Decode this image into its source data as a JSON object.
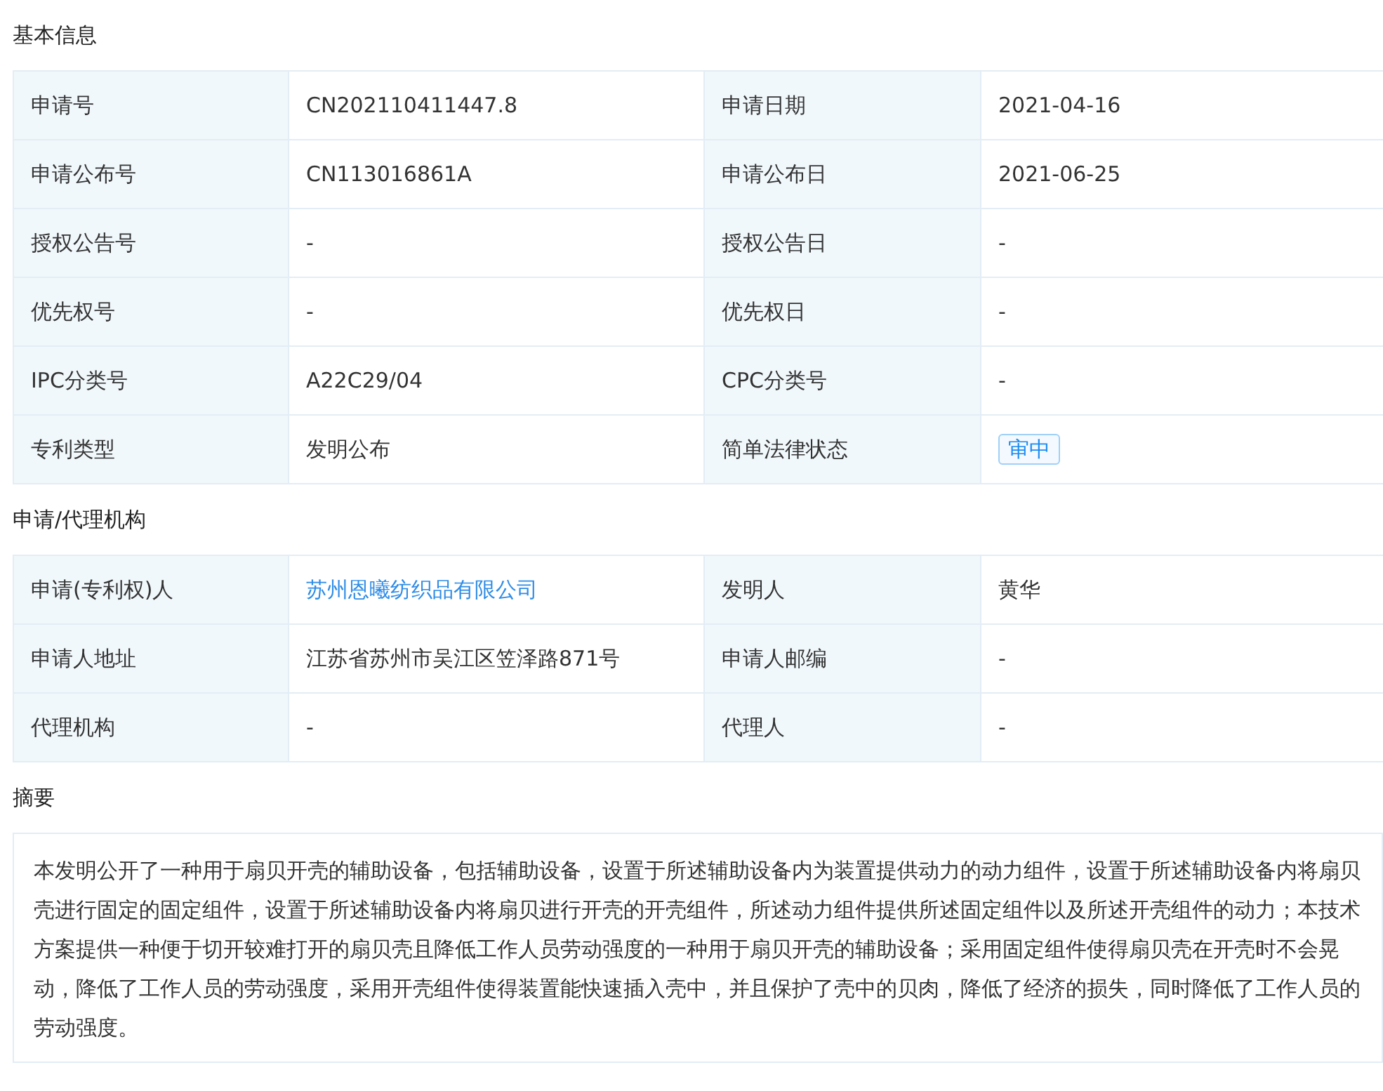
{
  "sections": [
    {
      "title": "基本信息",
      "kind": "table",
      "rows": [
        [
          {
            "label": "申请号",
            "value": "CN202110411447.8",
            "kind": "text"
          },
          {
            "label": "申请日期",
            "value": "2021-04-16",
            "kind": "text"
          }
        ],
        [
          {
            "label": "申请公布号",
            "value": "CN113016861A",
            "kind": "text"
          },
          {
            "label": "申请公布日",
            "value": "2021-06-25",
            "kind": "text"
          }
        ],
        [
          {
            "label": "授权公告号",
            "value": "-",
            "kind": "text"
          },
          {
            "label": "授权公告日",
            "value": "-",
            "kind": "text"
          }
        ],
        [
          {
            "label": "优先权号",
            "value": "-",
            "kind": "text"
          },
          {
            "label": "优先权日",
            "value": "-",
            "kind": "text"
          }
        ],
        [
          {
            "label": "IPC分类号",
            "value": "A22C29/04",
            "kind": "text"
          },
          {
            "label": "CPC分类号",
            "value": "-",
            "kind": "text"
          }
        ],
        [
          {
            "label": "专利类型",
            "value": "发明公布",
            "kind": "text"
          },
          {
            "label": "简单法律状态",
            "value": "审中",
            "kind": "tag"
          }
        ]
      ]
    },
    {
      "title": "申请/代理机构",
      "kind": "table",
      "rows": [
        [
          {
            "label": "申请(专利权)人",
            "value": "苏州恩曦纺织品有限公司",
            "kind": "link"
          },
          {
            "label": "发明人",
            "value": "黄华",
            "kind": "text"
          }
        ],
        [
          {
            "label": "申请人地址",
            "value": "江苏省苏州市吴江区笠泽路871号",
            "kind": "text"
          },
          {
            "label": "申请人邮编",
            "value": "-",
            "kind": "text"
          }
        ],
        [
          {
            "label": "代理机构",
            "value": "-",
            "kind": "text"
          },
          {
            "label": "代理人",
            "value": "-",
            "kind": "text"
          }
        ]
      ]
    },
    {
      "title": "摘要",
      "kind": "text",
      "text": "本发明公开了一种用于扇贝开壳的辅助设备，包括辅助设备，设置于所述辅助设备内为装置提供动力的动力组件，设置于所述辅助设备内将扇贝壳进行固定的固定组件，设置于所述辅助设备内将扇贝进行开壳的开壳组件，所述动力组件提供所述固定组件以及所述开壳组件的动力；本技术方案提供一种便于切开较难打开的扇贝壳且降低工作人员劳动强度的一种用于扇贝开壳的辅助设备；采用固定组件使得扇贝壳在开壳时不会晃动，降低了工作人员的劳动强度，采用开壳组件使得装置能快速插入壳中，并且保护了壳中的贝肉，降低了经济的损失，同时降低了工作人员的劳动强度。"
    }
  ]
}
